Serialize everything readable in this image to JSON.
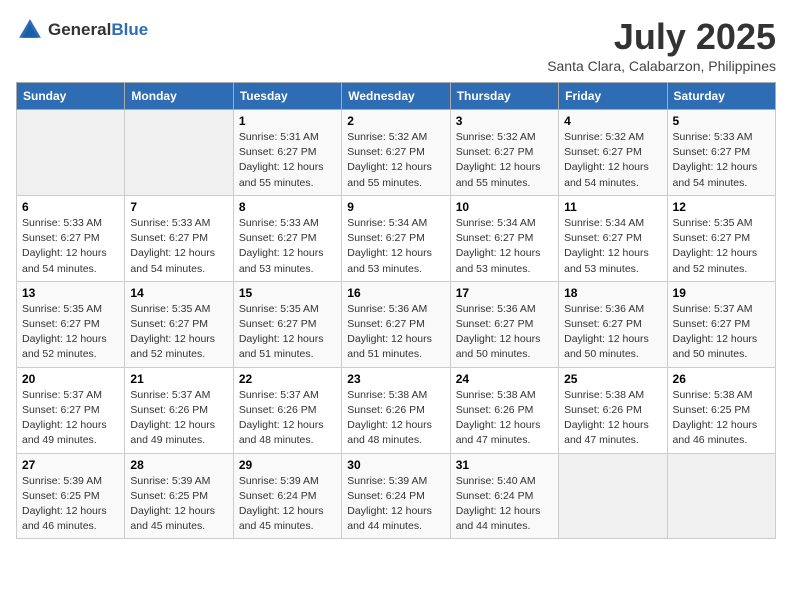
{
  "logo": {
    "general": "General",
    "blue": "Blue"
  },
  "title": "July 2025",
  "location": "Santa Clara, Calabarzon, Philippines",
  "headers": [
    "Sunday",
    "Monday",
    "Tuesday",
    "Wednesday",
    "Thursday",
    "Friday",
    "Saturday"
  ],
  "weeks": [
    [
      {
        "day": "",
        "sunrise": "",
        "sunset": "",
        "daylight": ""
      },
      {
        "day": "",
        "sunrise": "",
        "sunset": "",
        "daylight": ""
      },
      {
        "day": "1",
        "sunrise": "Sunrise: 5:31 AM",
        "sunset": "Sunset: 6:27 PM",
        "daylight": "Daylight: 12 hours and 55 minutes."
      },
      {
        "day": "2",
        "sunrise": "Sunrise: 5:32 AM",
        "sunset": "Sunset: 6:27 PM",
        "daylight": "Daylight: 12 hours and 55 minutes."
      },
      {
        "day": "3",
        "sunrise": "Sunrise: 5:32 AM",
        "sunset": "Sunset: 6:27 PM",
        "daylight": "Daylight: 12 hours and 55 minutes."
      },
      {
        "day": "4",
        "sunrise": "Sunrise: 5:32 AM",
        "sunset": "Sunset: 6:27 PM",
        "daylight": "Daylight: 12 hours and 54 minutes."
      },
      {
        "day": "5",
        "sunrise": "Sunrise: 5:33 AM",
        "sunset": "Sunset: 6:27 PM",
        "daylight": "Daylight: 12 hours and 54 minutes."
      }
    ],
    [
      {
        "day": "6",
        "sunrise": "Sunrise: 5:33 AM",
        "sunset": "Sunset: 6:27 PM",
        "daylight": "Daylight: 12 hours and 54 minutes."
      },
      {
        "day": "7",
        "sunrise": "Sunrise: 5:33 AM",
        "sunset": "Sunset: 6:27 PM",
        "daylight": "Daylight: 12 hours and 54 minutes."
      },
      {
        "day": "8",
        "sunrise": "Sunrise: 5:33 AM",
        "sunset": "Sunset: 6:27 PM",
        "daylight": "Daylight: 12 hours and 53 minutes."
      },
      {
        "day": "9",
        "sunrise": "Sunrise: 5:34 AM",
        "sunset": "Sunset: 6:27 PM",
        "daylight": "Daylight: 12 hours and 53 minutes."
      },
      {
        "day": "10",
        "sunrise": "Sunrise: 5:34 AM",
        "sunset": "Sunset: 6:27 PM",
        "daylight": "Daylight: 12 hours and 53 minutes."
      },
      {
        "day": "11",
        "sunrise": "Sunrise: 5:34 AM",
        "sunset": "Sunset: 6:27 PM",
        "daylight": "Daylight: 12 hours and 53 minutes."
      },
      {
        "day": "12",
        "sunrise": "Sunrise: 5:35 AM",
        "sunset": "Sunset: 6:27 PM",
        "daylight": "Daylight: 12 hours and 52 minutes."
      }
    ],
    [
      {
        "day": "13",
        "sunrise": "Sunrise: 5:35 AM",
        "sunset": "Sunset: 6:27 PM",
        "daylight": "Daylight: 12 hours and 52 minutes."
      },
      {
        "day": "14",
        "sunrise": "Sunrise: 5:35 AM",
        "sunset": "Sunset: 6:27 PM",
        "daylight": "Daylight: 12 hours and 52 minutes."
      },
      {
        "day": "15",
        "sunrise": "Sunrise: 5:35 AM",
        "sunset": "Sunset: 6:27 PM",
        "daylight": "Daylight: 12 hours and 51 minutes."
      },
      {
        "day": "16",
        "sunrise": "Sunrise: 5:36 AM",
        "sunset": "Sunset: 6:27 PM",
        "daylight": "Daylight: 12 hours and 51 minutes."
      },
      {
        "day": "17",
        "sunrise": "Sunrise: 5:36 AM",
        "sunset": "Sunset: 6:27 PM",
        "daylight": "Daylight: 12 hours and 50 minutes."
      },
      {
        "day": "18",
        "sunrise": "Sunrise: 5:36 AM",
        "sunset": "Sunset: 6:27 PM",
        "daylight": "Daylight: 12 hours and 50 minutes."
      },
      {
        "day": "19",
        "sunrise": "Sunrise: 5:37 AM",
        "sunset": "Sunset: 6:27 PM",
        "daylight": "Daylight: 12 hours and 50 minutes."
      }
    ],
    [
      {
        "day": "20",
        "sunrise": "Sunrise: 5:37 AM",
        "sunset": "Sunset: 6:27 PM",
        "daylight": "Daylight: 12 hours and 49 minutes."
      },
      {
        "day": "21",
        "sunrise": "Sunrise: 5:37 AM",
        "sunset": "Sunset: 6:26 PM",
        "daylight": "Daylight: 12 hours and 49 minutes."
      },
      {
        "day": "22",
        "sunrise": "Sunrise: 5:37 AM",
        "sunset": "Sunset: 6:26 PM",
        "daylight": "Daylight: 12 hours and 48 minutes."
      },
      {
        "day": "23",
        "sunrise": "Sunrise: 5:38 AM",
        "sunset": "Sunset: 6:26 PM",
        "daylight": "Daylight: 12 hours and 48 minutes."
      },
      {
        "day": "24",
        "sunrise": "Sunrise: 5:38 AM",
        "sunset": "Sunset: 6:26 PM",
        "daylight": "Daylight: 12 hours and 47 minutes."
      },
      {
        "day": "25",
        "sunrise": "Sunrise: 5:38 AM",
        "sunset": "Sunset: 6:26 PM",
        "daylight": "Daylight: 12 hours and 47 minutes."
      },
      {
        "day": "26",
        "sunrise": "Sunrise: 5:38 AM",
        "sunset": "Sunset: 6:25 PM",
        "daylight": "Daylight: 12 hours and 46 minutes."
      }
    ],
    [
      {
        "day": "27",
        "sunrise": "Sunrise: 5:39 AM",
        "sunset": "Sunset: 6:25 PM",
        "daylight": "Daylight: 12 hours and 46 minutes."
      },
      {
        "day": "28",
        "sunrise": "Sunrise: 5:39 AM",
        "sunset": "Sunset: 6:25 PM",
        "daylight": "Daylight: 12 hours and 45 minutes."
      },
      {
        "day": "29",
        "sunrise": "Sunrise: 5:39 AM",
        "sunset": "Sunset: 6:24 PM",
        "daylight": "Daylight: 12 hours and 45 minutes."
      },
      {
        "day": "30",
        "sunrise": "Sunrise: 5:39 AM",
        "sunset": "Sunset: 6:24 PM",
        "daylight": "Daylight: 12 hours and 44 minutes."
      },
      {
        "day": "31",
        "sunrise": "Sunrise: 5:40 AM",
        "sunset": "Sunset: 6:24 PM",
        "daylight": "Daylight: 12 hours and 44 minutes."
      },
      {
        "day": "",
        "sunrise": "",
        "sunset": "",
        "daylight": ""
      },
      {
        "day": "",
        "sunrise": "",
        "sunset": "",
        "daylight": ""
      }
    ]
  ]
}
